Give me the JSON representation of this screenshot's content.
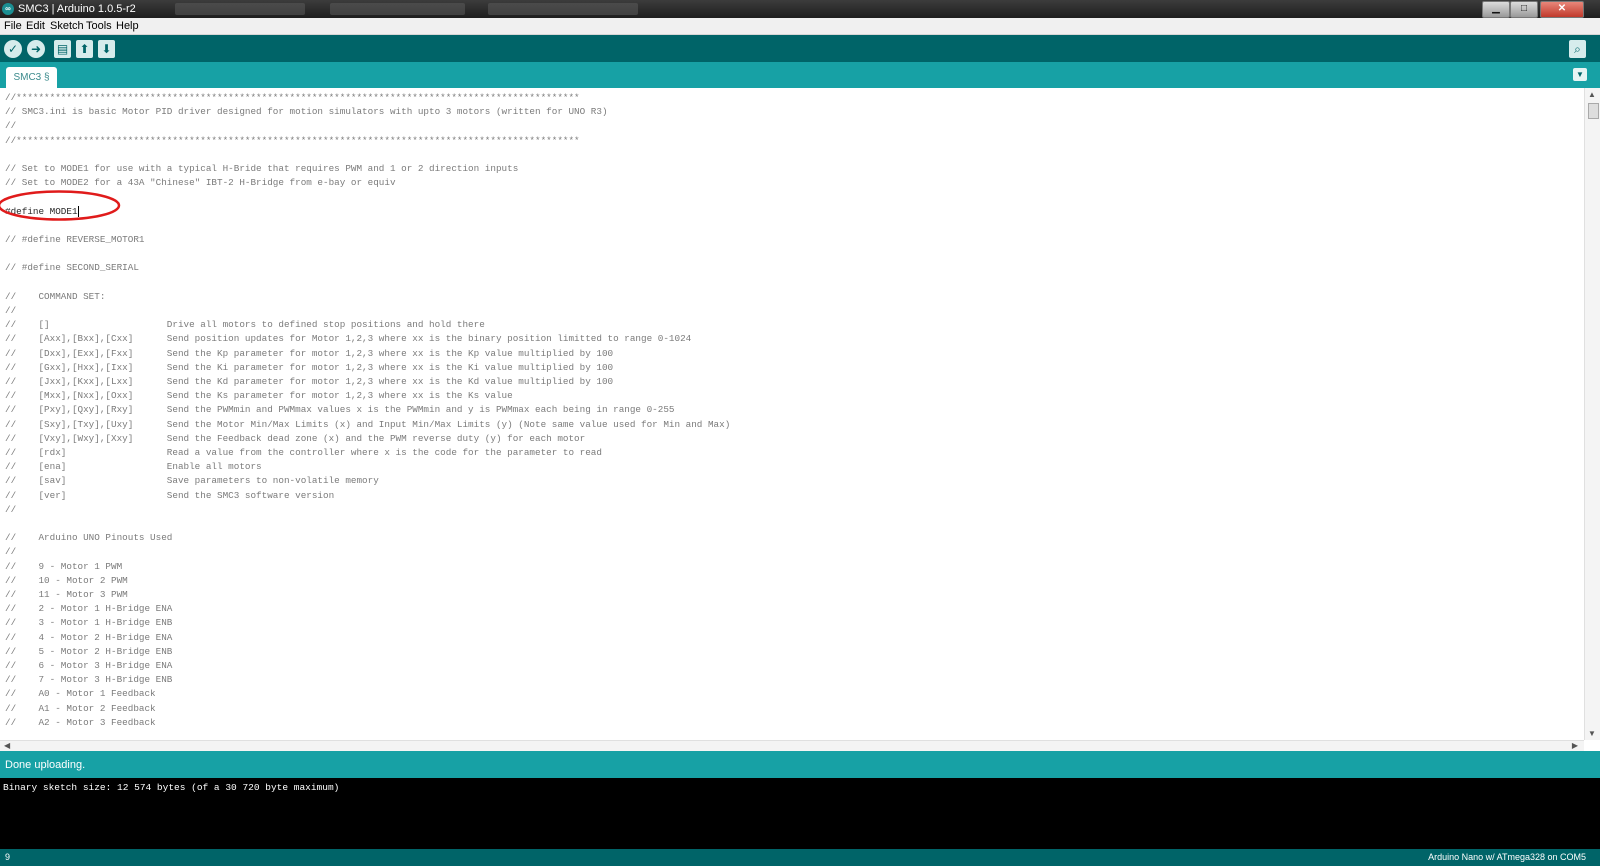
{
  "window": {
    "title": "SMC3 | Arduino 1.0.5-r2",
    "icon": "arduino-logo-icon",
    "controls": [
      "minimize",
      "maximize",
      "close"
    ]
  },
  "menu": [
    "File",
    "Edit",
    "Sketch",
    "Tools",
    "Help"
  ],
  "toolbar": {
    "buttons": [
      {
        "icon": "verify-check-icon",
        "glyph": "✓"
      },
      {
        "icon": "upload-arrow-icon",
        "glyph": "➜"
      },
      {
        "icon": "new-file-icon",
        "glyph": "▤"
      },
      {
        "icon": "open-up-arrow-icon",
        "glyph": "⬆"
      },
      {
        "icon": "save-down-arrow-icon",
        "glyph": "⬇"
      }
    ],
    "serial_monitor_icon": "magnifier-icon"
  },
  "tab": {
    "label": "SMC3 §",
    "menu_icon": "triangle-down-icon"
  },
  "editor": {
    "lines": [
      "//*****************************************************************************************************",
      "// SMC3.ini is basic Motor PID driver designed for motion simulators with upto 3 motors (written for UNO R3)",
      "//",
      "//*****************************************************************************************************",
      "",
      "// Set to MODE1 for use with a typical H-Bride that requires PWM and 1 or 2 direction inputs",
      "// Set to MODE2 for a 43A \"Chinese\" IBT-2 H-Bridge from e-bay or equiv",
      "",
      "#define MODE1",
      "",
      "// #define REVERSE_MOTOR1",
      "",
      "// #define SECOND_SERIAL",
      "",
      "//    COMMAND SET:",
      "//",
      "//    []                     Drive all motors to defined stop positions and hold there",
      "//    [Axx],[Bxx],[Cxx]      Send position updates for Motor 1,2,3 where xx is the binary position limitted to range 0-1024",
      "//    [Dxx],[Exx],[Fxx]      Send the Kp parameter for motor 1,2,3 where xx is the Kp value multiplied by 100",
      "//    [Gxx],[Hxx],[Ixx]      Send the Ki parameter for motor 1,2,3 where xx is the Ki value multiplied by 100",
      "//    [Jxx],[Kxx],[Lxx]      Send the Kd parameter for motor 1,2,3 where xx is the Kd value multiplied by 100",
      "//    [Mxx],[Nxx],[Oxx]      Send the Ks parameter for motor 1,2,3 where xx is the Ks value",
      "//    [Pxy],[Qxy],[Rxy]      Send the PWMmin and PWMmax values x is the PWMmin and y is PWMmax each being in range 0-255",
      "//    [Sxy],[Txy],[Uxy]      Send the Motor Min/Max Limits (x) and Input Min/Max Limits (y) (Note same value used for Min and Max)",
      "//    [Vxy],[Wxy],[Xxy]      Send the Feedback dead zone (x) and the PWM reverse duty (y) for each motor",
      "//    [rdx]                  Read a value from the controller where x is the code for the parameter to read",
      "//    [ena]                  Enable all motors",
      "//    [sav]                  Save parameters to non-volatile memory",
      "//    [ver]                  Send the SMC3 software version",
      "//",
      "",
      "//    Arduino UNO Pinouts Used",
      "//",
      "//    9 - Motor 1 PWM",
      "//    10 - Motor 2 PWM",
      "//    11 - Motor 3 PWM",
      "//    2 - Motor 1 H-Bridge ENA",
      "//    3 - Motor 1 H-Bridge ENB",
      "//    4 - Motor 2 H-Bridge ENA",
      "//    5 - Motor 2 H-Bridge ENB",
      "//    6 - Motor 3 H-Bridge ENA",
      "//    7 - Motor 3 H-Bridge ENB",
      "//    A0 - Motor 1 Feedback",
      "//    A1 - Motor 2 Feedback",
      "//    A2 - Motor 3 Feedback"
    ],
    "highlight_color": "#e01b1b"
  },
  "status": {
    "message": "Done uploading."
  },
  "console": {
    "output": "Binary sketch size: 12 574 bytes (of a 30 720 byte maximum)"
  },
  "footer": {
    "line_number": "9",
    "board": "Arduino Nano w/ ATmega328 on COM5"
  },
  "colors": {
    "teal_dark": "#006468",
    "teal": "#17a1a5"
  }
}
